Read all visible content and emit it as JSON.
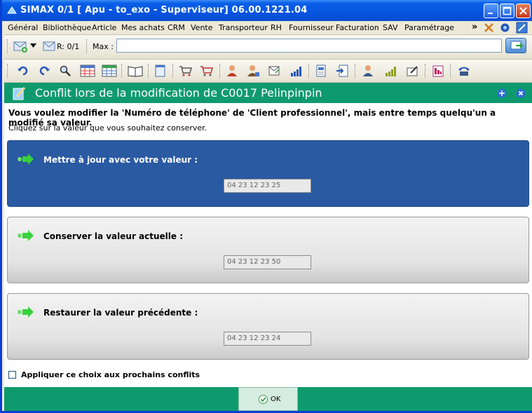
{
  "window": {
    "title": "SIMAX 0/1 [ Apu - to_exo - Superviseur] 06.00.1221.04"
  },
  "menu": [
    "Général",
    "Bibliothèque",
    "Article",
    "Mes achats",
    "CRM",
    "Vente",
    "Transporteur",
    "RH",
    "Fournisseur",
    "Facturation",
    "SAV",
    "Paramétrage"
  ],
  "menu_more": "»",
  "toolbar": {
    "mail_counter": "R: 0/1",
    "max_label": "Max :",
    "max_value": ""
  },
  "dialog": {
    "title": "Conflit lors de la modification de C0017 Pelinpinpin",
    "message": "Vous voulez modifier la 'Numéro de téléphone' de 'Client professionnel', mais entre temps quelqu'un a modifié sa valeur.",
    "instruction": "Cliquez sur la valeur que vous souhaitez conserver.",
    "options": [
      {
        "label": "Mettre à jour avec votre valeur :",
        "value": "04 23 12 23 25"
      },
      {
        "label": "Conserver la valeur actuelle :",
        "value": "04 23 12 23 50"
      },
      {
        "label": "Restaurer la valeur précédente :",
        "value": "04 23 12 23 24"
      }
    ],
    "apply_label": "Appliquer ce choix aux prochains conflits",
    "ok_label": "OK"
  },
  "colors": {
    "header": "#0f9a6d",
    "active_option": "#2a5aa2",
    "titlebar": "#0654e0"
  }
}
